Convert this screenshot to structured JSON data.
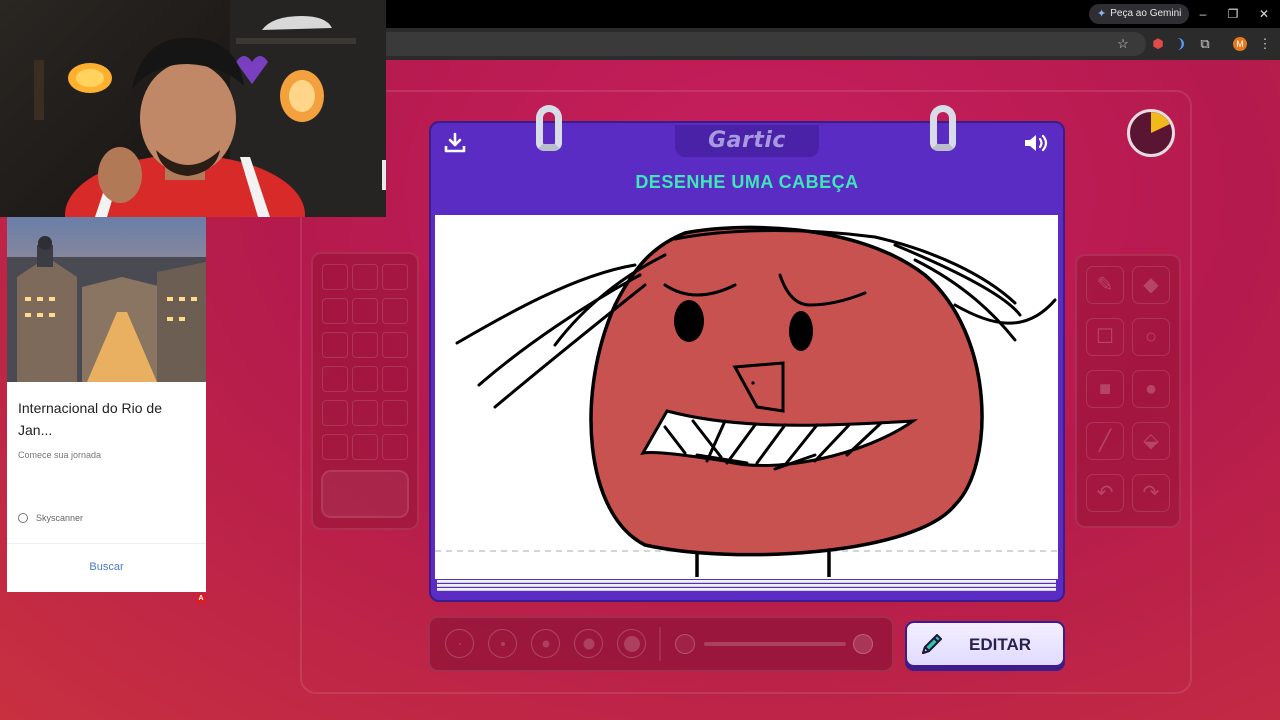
{
  "browser": {
    "gemini_label": "Peça ao Gemini",
    "avatar_letter": "M"
  },
  "ad": {
    "title": "Internacional do Rio de Jan...",
    "subtitle": "Comece sua jornada",
    "source": "Skyscanner",
    "cta": "Buscar",
    "badge": "A"
  },
  "game": {
    "logo": "Gartic",
    "prompt": "DESENHE UMA CABEÇA",
    "edit_label": "EDITAR",
    "colors": {
      "board": "#5a2cc4",
      "prompt": "#3ee6b8",
      "drawing_fill": "#c8524f",
      "background": "#b41a4d"
    },
    "timer_progress": 0.18,
    "tools": [
      "pencil-icon",
      "eraser-icon",
      "rectangle-outline-icon",
      "circle-outline-icon",
      "rectangle-filled-icon",
      "circle-filled-icon",
      "line-icon",
      "fill-bucket-icon",
      "undo-icon",
      "redo-icon"
    ]
  }
}
